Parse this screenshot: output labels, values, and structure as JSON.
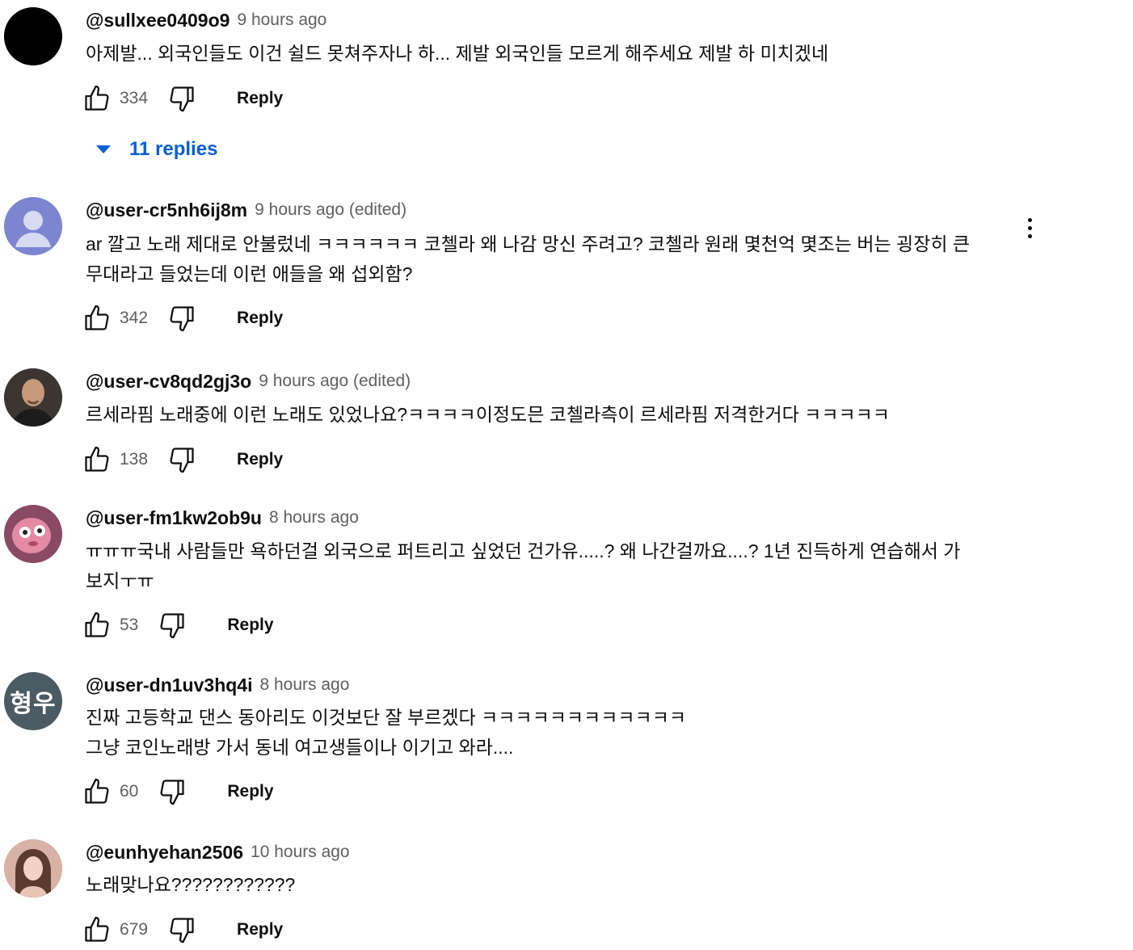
{
  "comments": [
    {
      "author": "@sullxee0409o9",
      "time": "9 hours ago",
      "text": "아제발... 외국인들도 이건 쉴드 못쳐주자나 하... 제발 외국인들 모르게 해주세요 제발 하 미치겠네",
      "likes": "334",
      "reply_label": "Reply",
      "replies_label": "11 replies",
      "avatar_icon": "black-circle-avatar"
    },
    {
      "author": "@user-cr5nh6ij8m",
      "time": "9 hours ago (edited)",
      "text": "ar 깔고 노래 제대로 안불렀네 ㅋㅋㅋㅋㅋㅋ 코첼라 왜 나감 망신 주려고? 코첼라 원래 몇천억 몇조는 버는 굉장히 큰\n무대라고 들었는데 이런 애들을 왜 섭외함?",
      "likes": "342",
      "reply_label": "Reply",
      "avatar_icon": "default-person-avatar",
      "menu_icon": "more-vert-icon"
    },
    {
      "author": "@user-cv8qd2gj3o",
      "time": "9 hours ago (edited)",
      "text": "르세라핌 노래중에 이런 노래도 있었나요?ㅋㅋㅋㅋ이정도믄 코첼라측이 르세라핌 저격한거다 ㅋㅋㅋㅋㅋ",
      "likes": "138",
      "reply_label": "Reply",
      "avatar_icon": "photo-avatar-man"
    },
    {
      "author": "@user-fm1kw2ob9u",
      "time": "8 hours ago",
      "text": "ㅠㅠㅠ국내 사람들만 욕하던걸 외국으로 퍼트리고 싶었던 건가유.....? 왜 나간걸까요....? 1년 진득하게 연습해서 가\n보지ㅜㅠ",
      "likes": "53",
      "reply_label": "Reply",
      "avatar_icon": "pink-cartoon-avatar"
    },
    {
      "author": "@user-dn1uv3hq4i",
      "time": "8 hours ago",
      "text": "진짜 고등학교 댄스 동아리도 이것보단 잘 부르겠다 ㅋㅋㅋㅋㅋㅋㅋㅋㅋㅋㅋㅋ\n그냥 코인노래방 가서 동네 여고생들이나 이기고 와라....",
      "likes": "60",
      "reply_label": "Reply",
      "avatar_text": "형우",
      "avatar_icon": "initials-avatar"
    },
    {
      "author": "@eunhyehan2506",
      "time": "10 hours ago",
      "text": "노래맞나요????????????",
      "likes": "679",
      "reply_label": "Reply",
      "avatar_icon": "photo-avatar-woman"
    }
  ],
  "colors": {
    "link_blue": "#065fd4",
    "secondary_text": "#606060",
    "primary_text": "#0f0f0f",
    "initials_avatar_bg": "#4b5a63",
    "default_avatar_bg": "#7c86d0"
  }
}
